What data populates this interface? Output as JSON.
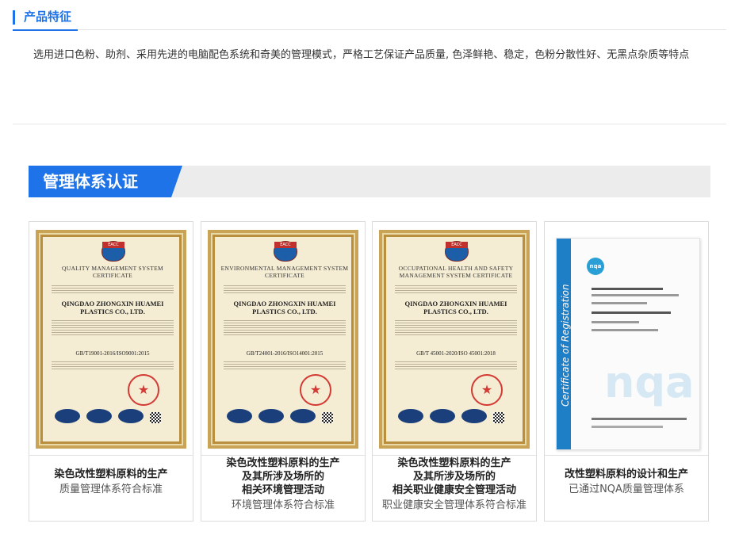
{
  "features": {
    "title": "产品特征",
    "text": "选用进口色粉、助剂、采用先进的电脑配色系统和奇美的管理模式，严格工艺保证产品质量, 色泽鲜艳、稳定，色粉分散性好、无黑点杂质等特点"
  },
  "management": {
    "title": "管理体系认证"
  },
  "colors": {
    "accent": "#1e73e8",
    "banner_bg": "#ececec"
  },
  "certificates": [
    {
      "image": {
        "logo": "EACC",
        "heading": "QUALITY MANAGEMENT SYSTEM CERTIFICATE",
        "company": "QINGDAO ZHONGXIN HUAMEI PLASTICS CO., LTD.",
        "standard": "GB/T19001-2016/ISO9001:2015"
      },
      "title_lines": [
        "染色改性塑料原料的生产"
      ],
      "subtitle": "质量管理体系符合标准"
    },
    {
      "image": {
        "logo": "EACC",
        "heading": "ENVIRONMENTAL MANAGEMENT SYSTEM CERTIFICATE",
        "company": "QINGDAO ZHONGXIN HUAMEI PLASTICS CO., LTD.",
        "standard": "GB/T24001-2016/ISO14001:2015"
      },
      "title_lines": [
        "染色改性塑料原料的生产",
        "及其所涉及场所的",
        "相关环境管理活动"
      ],
      "subtitle": "环境管理体系符合标准"
    },
    {
      "image": {
        "logo": "EACC",
        "heading": "OCCUPATIONAL HEALTH AND SAFETY MANAGEMENT SYSTEM CERTIFICATE",
        "company": "QINGDAO ZHONGXIN HUAMEI PLASTICS CO., LTD.",
        "standard": "GB/T 45001-2020/ISO 45001:2018"
      },
      "title_lines": [
        "染色改性塑料原料的生产",
        "及其所涉及场所的",
        "相关职业健康安全管理活动"
      ],
      "subtitle": "职业健康安全管理体系符合标准"
    },
    {
      "image": {
        "logo": "nqa",
        "vertical": "Certificate of Registration",
        "watermark": "nqa"
      },
      "title_lines": [
        "改性塑料原料的设计和生产"
      ],
      "subtitle": "已通过NQA质量管理体系"
    }
  ]
}
